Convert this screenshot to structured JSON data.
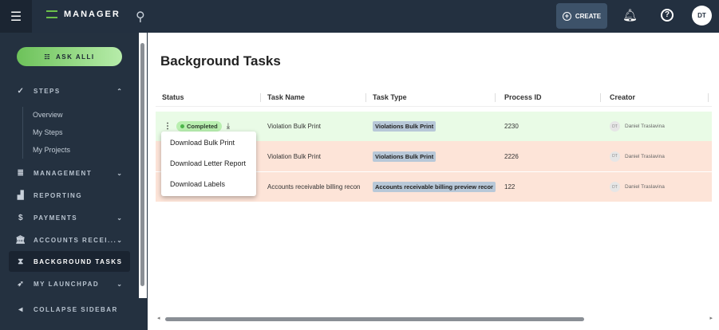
{
  "header": {
    "app_name": "MANAGER",
    "create_label": "CREATE",
    "avatar": "DT"
  },
  "sidebar": {
    "ask_label": "ASK ALLI",
    "items": [
      {
        "label": "STEPS"
      },
      {
        "label": "MANAGEMENT"
      },
      {
        "label": "REPORTING"
      },
      {
        "label": "PAYMENTS"
      },
      {
        "label": "ACCOUNTS RECEI..."
      },
      {
        "label": "BACKGROUND TASKS"
      },
      {
        "label": "MY LAUNCHPAD"
      },
      {
        "label": "COLLAPSE SIDEBAR"
      }
    ],
    "steps_sub": [
      "Overview",
      "My Steps",
      "My Projects"
    ]
  },
  "main": {
    "title": "Background Tasks",
    "columns": [
      "Status",
      "Task Name",
      "Task Type",
      "Process ID",
      "Creator"
    ],
    "rows": [
      {
        "status": "Completed",
        "task_name": "Violation Bulk Print",
        "task_type": "Violations Bulk Print",
        "process_id": "2230",
        "creator_initials": "DT",
        "creator": "Daniel Traslavina"
      },
      {
        "task_name": "Violation Bulk Print",
        "task_type": "Violations Bulk Print",
        "process_id": "2226",
        "creator_initials": "DT",
        "creator": "Daniel Traslavina"
      },
      {
        "task_name": "Accounts receivable billing recon",
        "task_type": "Accounts receivable billing preview recor",
        "process_id": "122",
        "creator_initials": "DT",
        "creator": "Daniel Traslavina"
      }
    ],
    "menu": [
      "Download Bulk Print",
      "Download Letter Report",
      "Download Labels"
    ]
  }
}
